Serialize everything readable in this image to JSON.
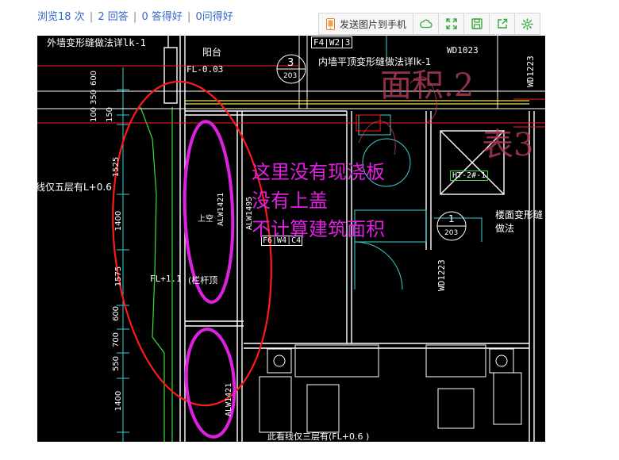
{
  "stats": {
    "views": "浏览18 次",
    "answers": "2 回答",
    "good_answers": "0 答得好",
    "good_questions": "0问得好",
    "separator": "|"
  },
  "toolbar": {
    "send_label": "发送图片到手机",
    "icons": [
      "phone-icon",
      "cloud-icon",
      "fullscreen-icon",
      "save-icon",
      "share-icon",
      "settings-icon"
    ],
    "accent": "#3aa63a"
  },
  "drawing": {
    "annotation_lines": [
      "这里没有现浇板",
      "没有上盖",
      "不计算建筑面积"
    ],
    "annotation_color": "#e020e0",
    "labels": {
      "top_left_title": "外墙变形缝做法详lk-1",
      "platform": "阳台",
      "fl_top": "FL-0.03",
      "callout_num": "3",
      "callout_sub": "203",
      "top_mid_code": "F4|W2|3",
      "top_mid_title": "内墙平顶变形缝做法详lk-1",
      "top_right_code": "WD1023",
      "right_vertical_code": "WD1223",
      "area_text": "面积.2",
      "table_text": "表3",
      "left_floor": "线仅五层有L+0.6",
      "dims": [
        "600",
        "350",
        "100",
        "150",
        "1525",
        "1400",
        "1575",
        "600",
        "700",
        "550",
        "1400"
      ],
      "upper_room": "上空",
      "vertical_code1": "ALW1421",
      "vertical_code2": "ALW1495",
      "f6": "F6|W4|C4",
      "fl_11": "FL+1.1",
      "railing": "(栏杆顶",
      "ht": "HT-2#-1",
      "floor_joint": "楼面变形缝做法",
      "callout2_num": "1",
      "callout2_sub": "203",
      "bottom_note": "此看线仅三层有(FL+0.6 )",
      "vertical_code3": "ALW1421"
    },
    "colors": {
      "red": "#ff1a1a",
      "magenta": "#e020e0",
      "cyan": "#40d0d0",
      "green": "#36e036",
      "white": "#ffffff",
      "yellow": "#e8e040"
    }
  }
}
